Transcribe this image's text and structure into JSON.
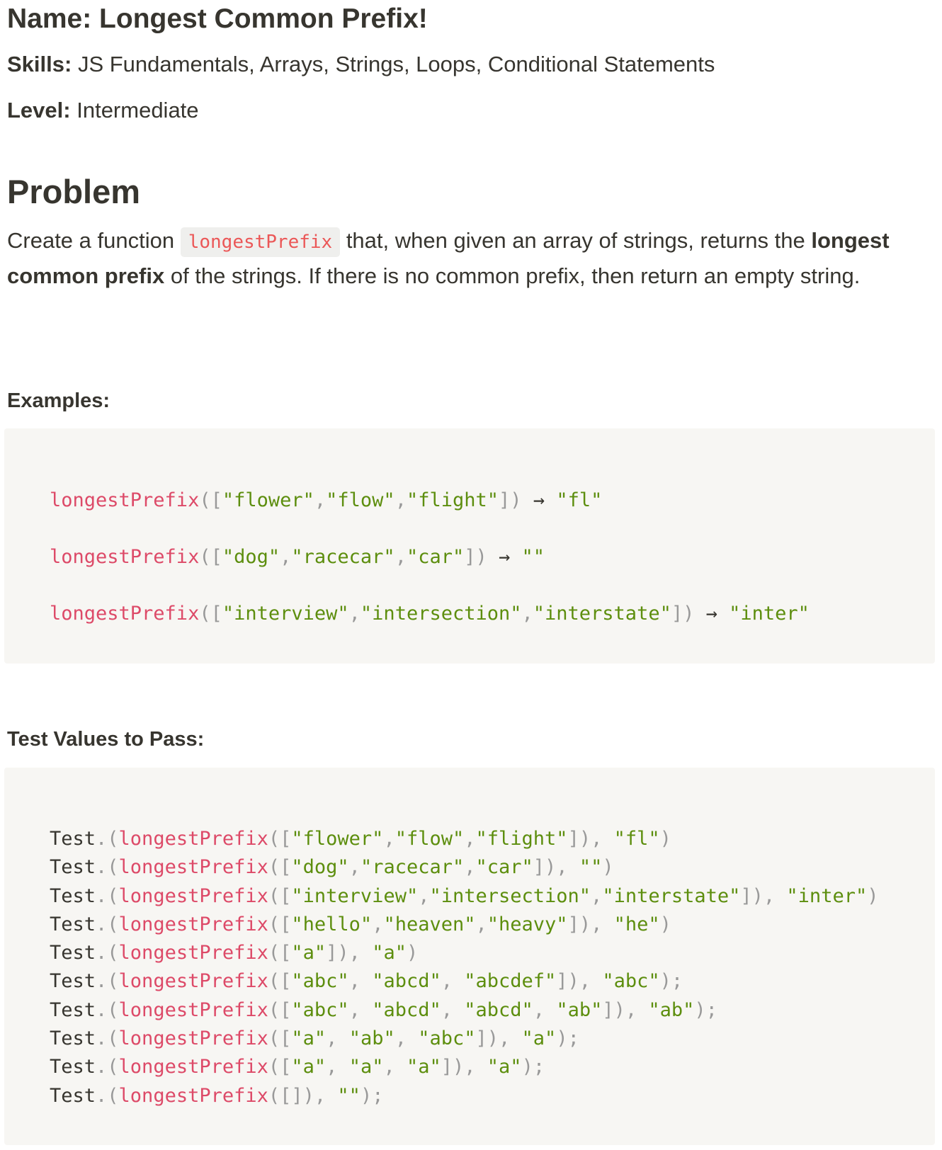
{
  "meta": {
    "name_label": "Name:",
    "name_value": " Longest Common Prefix!",
    "skills_label": "Skills:",
    "skills_value": " JS Fundamentals, Arrays, Strings, Loops, Conditional Statements",
    "level_label": "Level:",
    "level_value": " Intermediate"
  },
  "problem": {
    "heading": "Problem",
    "text_before_code": "Create a function ",
    "function_name": "longestPrefix",
    "text_after_code": " that, when given an array of strings, returns the ",
    "bold_phrase": "longest common prefix",
    "text_end": " of the strings. If there is no common prefix, then return an empty string."
  },
  "examples": {
    "heading": "Examples:",
    "lines": [
      {
        "fn": "longestPrefix",
        "args": [
          "\"flower\"",
          "\"flow\"",
          "\"flight\""
        ],
        "result": "\"fl\""
      },
      {
        "fn": "longestPrefix",
        "args": [
          "\"dog\"",
          "\"racecar\"",
          "\"car\""
        ],
        "result": "\"\""
      },
      {
        "fn": "longestPrefix",
        "args": [
          "\"interview\"",
          "\"intersection\"",
          "\"interstate\""
        ],
        "result": "\"inter\""
      }
    ]
  },
  "tests": {
    "heading": "Test Values to Pass:",
    "lines": [
      {
        "obj": "Test",
        "fn": "longestPrefix",
        "args": [
          "\"flower\"",
          "\"flow\"",
          "\"flight\""
        ],
        "sep": ",",
        "expected": "\"fl\"",
        "end": ")"
      },
      {
        "obj": "Test",
        "fn": "longestPrefix",
        "args": [
          "\"dog\"",
          "\"racecar\"",
          "\"car\""
        ],
        "sep": ",",
        "expected": "\"\"",
        "end": ")"
      },
      {
        "obj": "Test",
        "fn": "longestPrefix",
        "args": [
          "\"interview\"",
          "\"intersection\"",
          "\"interstate\""
        ],
        "sep": ",",
        "expected": "\"inter\"",
        "end": ")"
      },
      {
        "obj": "Test",
        "fn": "longestPrefix",
        "args": [
          "\"hello\"",
          "\"heaven\"",
          "\"heavy\""
        ],
        "sep": ",",
        "expected": "\"he\"",
        "end": ")"
      },
      {
        "obj": "Test",
        "fn": "longestPrefix",
        "args": [
          "\"a\""
        ],
        "sep": ",",
        "expected": "\"a\"",
        "end": ")"
      },
      {
        "obj": "Test",
        "fn": "longestPrefix",
        "args": [
          "\"abc\"",
          "\"abcd\"",
          "\"abcdef\""
        ],
        "sep": ", ",
        "expected": "\"abc\"",
        "end": ");"
      },
      {
        "obj": "Test",
        "fn": "longestPrefix",
        "args": [
          "\"abc\"",
          "\"abcd\"",
          "\"abcd\"",
          "\"ab\""
        ],
        "sep": ", ",
        "expected": "\"ab\"",
        "end": ");"
      },
      {
        "obj": "Test",
        "fn": "longestPrefix",
        "args": [
          "\"a\"",
          "\"ab\"",
          "\"abc\""
        ],
        "sep": ", ",
        "expected": "\"a\"",
        "end": ");"
      },
      {
        "obj": "Test",
        "fn": "longestPrefix",
        "args": [
          "\"a\"",
          "\"a\"",
          "\"a\""
        ],
        "sep": ", ",
        "expected": "\"a\"",
        "end": ");"
      },
      {
        "obj": "Test",
        "fn": "longestPrefix",
        "args": [],
        "sep": ",",
        "expected": "\"\"",
        "end": ");"
      }
    ]
  },
  "colors": {
    "function": "#dd4a68",
    "string": "#5d8e0e",
    "punctuation": "#999999",
    "inline_code": "#eb5757",
    "code_background": "#f7f6f3",
    "text": "#37352f"
  }
}
